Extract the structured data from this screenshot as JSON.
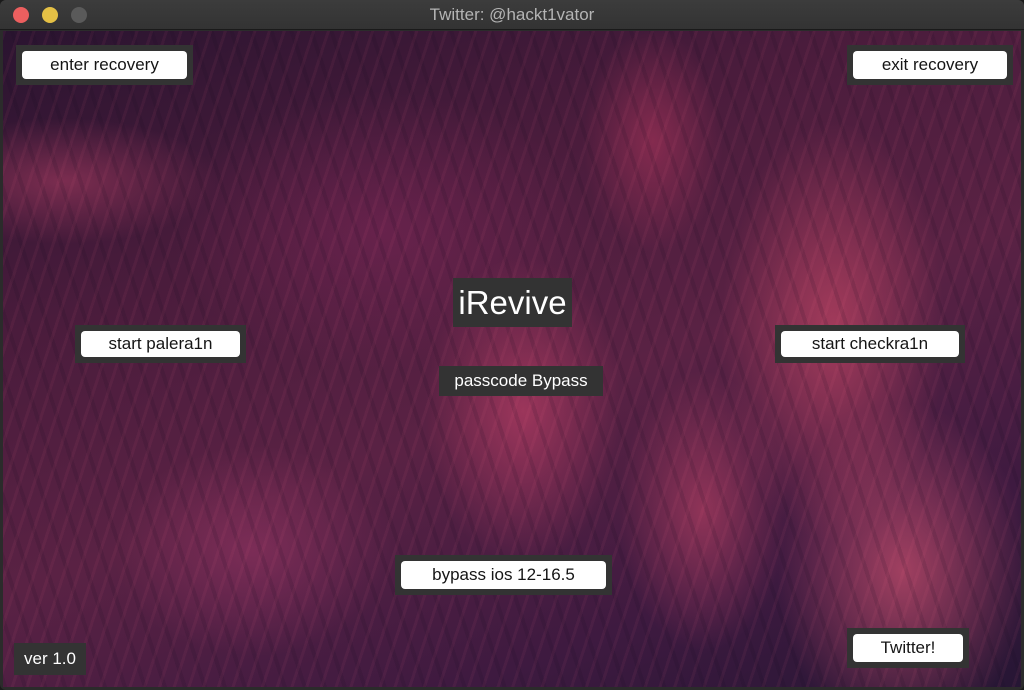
{
  "window": {
    "title": "Twitter: @hackt1vator",
    "controls": {
      "close": "close",
      "minimize": "minimize",
      "maximize": "maximize"
    }
  },
  "app": {
    "name": "iRevive",
    "subtitle": "passcode Bypass",
    "version": "ver 1.0"
  },
  "buttons": {
    "enter_recovery": "enter recovery",
    "exit_recovery": "exit recovery",
    "start_palera1n": "start palera1n",
    "start_checkra1n": "start checkra1n",
    "bypass": "bypass ios 12-16.5",
    "twitter": "Twitter!"
  }
}
